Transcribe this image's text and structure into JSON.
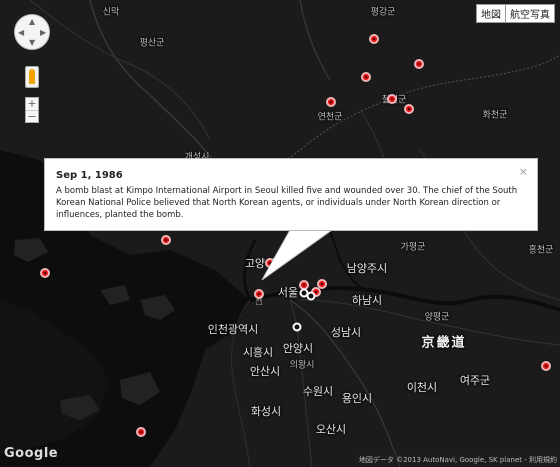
{
  "map": {
    "controls": {
      "pan_up": "▲",
      "pan_down": "▼",
      "pan_left": "◀",
      "pan_right": "▶",
      "zoom_in": "+",
      "zoom_out": "−",
      "maptype_map": "地図",
      "maptype_satellite": "航空写真"
    },
    "labels": [
      {
        "text": "신막",
        "cls": "small"
      },
      {
        "text": "평강군",
        "cls": "small"
      },
      {
        "text": "평산군",
        "cls": "small"
      },
      {
        "text": "연천군",
        "cls": "small"
      },
      {
        "text": "철원군",
        "cls": "small"
      },
      {
        "text": "화천군",
        "cls": "small"
      },
      {
        "text": "개성시",
        "cls": "small"
      },
      {
        "text": "가평군",
        "cls": "small"
      },
      {
        "text": "홍천군",
        "cls": "small"
      },
      {
        "text": "고양시",
        "cls": "med"
      },
      {
        "text": "남양주시",
        "cls": "med"
      },
      {
        "text": "서울",
        "cls": "med"
      },
      {
        "text": "하남시",
        "cls": "med"
      },
      {
        "text": "양평군",
        "cls": "small"
      },
      {
        "text": "인천광역시",
        "cls": "med"
      },
      {
        "text": "성남시",
        "cls": "med"
      },
      {
        "text": "京畿道",
        "cls": "big"
      },
      {
        "text": "시흥시",
        "cls": "med"
      },
      {
        "text": "안양시",
        "cls": "med"
      },
      {
        "text": "의왕시",
        "cls": "small"
      },
      {
        "text": "안산시",
        "cls": "med"
      },
      {
        "text": "수원시",
        "cls": "med"
      },
      {
        "text": "용인시",
        "cls": "med"
      },
      {
        "text": "이천시",
        "cls": "med"
      },
      {
        "text": "여주군",
        "cls": "med"
      },
      {
        "text": "화성시",
        "cls": "med"
      },
      {
        "text": "오산시",
        "cls": "med"
      }
    ],
    "markers": [
      {
        "kind": "red"
      },
      {
        "kind": "red"
      },
      {
        "kind": "red"
      },
      {
        "kind": "red"
      },
      {
        "kind": "red"
      },
      {
        "kind": "red"
      },
      {
        "kind": "red"
      },
      {
        "kind": "red"
      },
      {
        "kind": "red"
      },
      {
        "kind": "red"
      },
      {
        "kind": "red"
      },
      {
        "kind": "red"
      },
      {
        "kind": "red"
      },
      {
        "kind": "red"
      },
      {
        "kind": "red"
      },
      {
        "kind": "white"
      },
      {
        "kind": "white"
      },
      {
        "kind": "white"
      }
    ],
    "info_window": {
      "title": "Sep 1, 1986",
      "body": "A bomb blast at Kimpo International Airport in Seoul killed five and wounded over 30. The chief of the South Korean National Police believed that North Korean agents, or individuals under North Korean direction or influences, planted the bomb.",
      "close": "×"
    },
    "logo": "Google",
    "attribution": "地図データ ©2013 AutoNavi, Google, SK planet -  利用規約"
  }
}
